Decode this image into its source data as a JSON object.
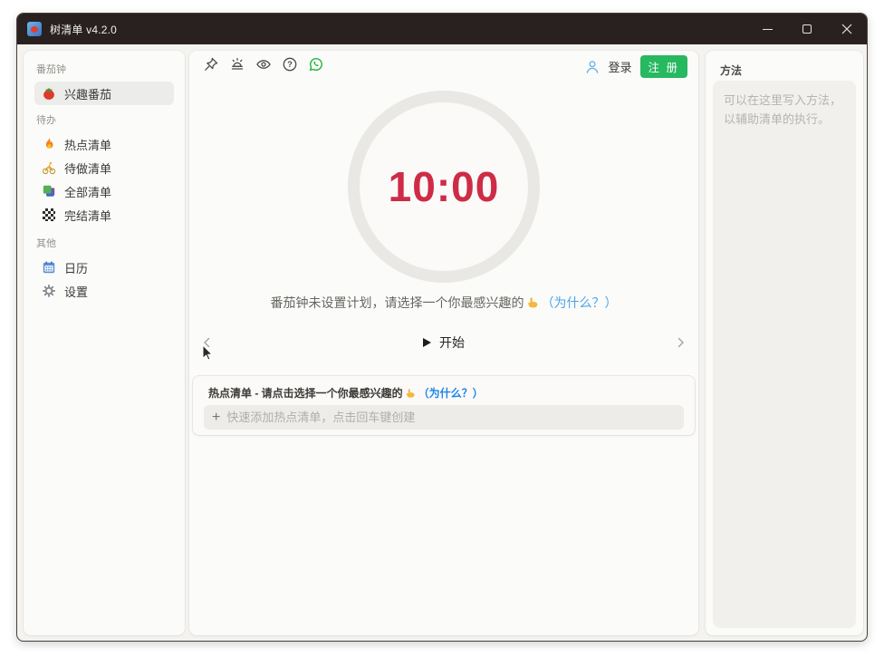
{
  "window": {
    "title": "树清单 v4.2.0",
    "control_icons": [
      "minimize-icon",
      "maximize-icon",
      "close-icon"
    ]
  },
  "sidebar": {
    "sections": [
      {
        "label": "番茄钟",
        "items": [
          {
            "icon": "tomato-icon",
            "label": "兴趣番茄",
            "selected": true
          }
        ]
      },
      {
        "label": "待办",
        "items": [
          {
            "icon": "fire-icon",
            "label": "热点清单"
          },
          {
            "icon": "cyclist-icon",
            "label": "待做清单"
          },
          {
            "icon": "stacked-squares-icon",
            "label": "全部清单"
          },
          {
            "icon": "checkerboard-icon",
            "label": "完结清单"
          }
        ]
      },
      {
        "label": "其他",
        "items": [
          {
            "icon": "calendar-icon",
            "label": "日历"
          },
          {
            "icon": "gear-icon",
            "label": "设置"
          }
        ]
      }
    ]
  },
  "toolbar": {
    "icons": [
      "pin-icon",
      "alarm-icon",
      "eye-icon",
      "help-icon",
      "whatsapp-icon"
    ],
    "login_label": "登录",
    "register_label": "注 册"
  },
  "timer": {
    "time": "10:00",
    "caption_text": "番茄钟未设置计划，请选择一个你最感兴趣的",
    "caption_link": "（为什么？）",
    "start_label": "开始"
  },
  "hotlist": {
    "header_text": "热点清单 - 请点击选择一个你最感兴趣的",
    "header_link": "（为什么？）",
    "plus": "+",
    "input_placeholder": "快速添加热点清单，点击回车键创建"
  },
  "methods_panel": {
    "title": "方法",
    "placeholder": "可以在这里写入方法，以辅助清单的执行。"
  },
  "colors": {
    "titlebar": "#282120",
    "accent_green": "#27b860",
    "timer_red": "#ce2b47",
    "link_blue": "#4aa4ea",
    "link_blue_bold": "#1e86e6"
  }
}
